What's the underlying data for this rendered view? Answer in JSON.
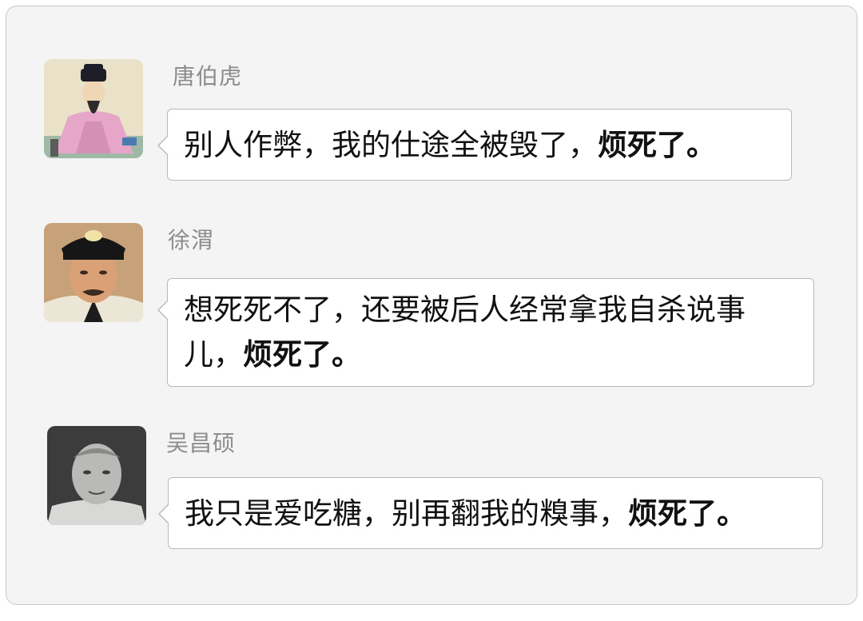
{
  "messages": [
    {
      "sender": "唐伯虎",
      "avatar_icon": "portrait-tang-bohu-icon",
      "text": "别人作弊，我的仕途全被毁了，",
      "emphasis": "烦死了。"
    },
    {
      "sender": "徐渭",
      "avatar_icon": "portrait-xu-wei-icon",
      "text": "想死死不了，还要被后人经常拿我自杀说事儿，",
      "emphasis": "烦死了。"
    },
    {
      "sender": "吴昌硕",
      "avatar_icon": "portrait-wu-changshuo-icon",
      "text": "我只是爱吃糖，别再翻我的糗事，",
      "emphasis": "烦死了。"
    }
  ],
  "colors": {
    "background": "#f4f4f4",
    "bubble": "#ffffff",
    "bubble_border": "#b9b9b9",
    "sender_name": "#8c8c8c"
  }
}
